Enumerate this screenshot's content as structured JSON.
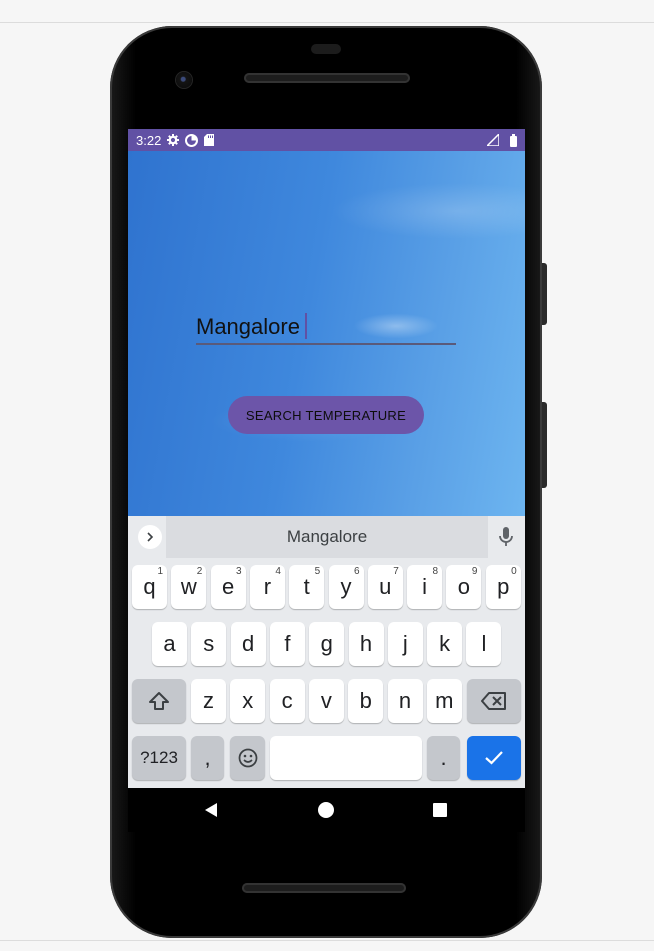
{
  "status_bar": {
    "time": "3:22",
    "icons_left": [
      "gear-icon",
      "data-saver-icon",
      "sd-card-icon"
    ],
    "icons_right": [
      "signal-icon",
      "battery-icon"
    ],
    "color": "#6151a4"
  },
  "app": {
    "city_input_value": "Mangalore",
    "search_button_label": "SEARCH TEMPERATURE",
    "button_color": "#6c55a9"
  },
  "keyboard": {
    "suggestion": "Mangalore",
    "row1": [
      {
        "k": "q",
        "h": "1"
      },
      {
        "k": "w",
        "h": "2"
      },
      {
        "k": "e",
        "h": "3"
      },
      {
        "k": "r",
        "h": "4"
      },
      {
        "k": "t",
        "h": "5"
      },
      {
        "k": "y",
        "h": "6"
      },
      {
        "k": "u",
        "h": "7"
      },
      {
        "k": "i",
        "h": "8"
      },
      {
        "k": "o",
        "h": "9"
      },
      {
        "k": "p",
        "h": "0"
      }
    ],
    "row2": [
      "a",
      "s",
      "d",
      "f",
      "g",
      "h",
      "j",
      "k",
      "l"
    ],
    "row3": [
      "z",
      "x",
      "c",
      "v",
      "b",
      "n",
      "m"
    ],
    "symbols_label": "?123",
    "comma": ",",
    "period": ".",
    "action_color": "#1a73e8"
  },
  "nav": {
    "icons": [
      "back-icon",
      "home-icon",
      "recents-icon"
    ]
  }
}
